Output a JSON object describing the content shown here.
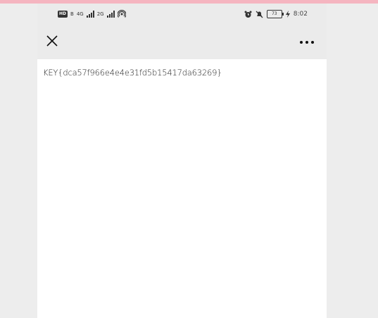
{
  "status_bar": {
    "hd": "HD",
    "b": "B",
    "net1": "4G",
    "net2": "2G",
    "battery": "73",
    "time": "8:02"
  },
  "icons": {
    "close": "close-icon",
    "more": "more-icon",
    "alarm": "alarm-icon",
    "mute": "mute-icon",
    "hotspot": "hotspot-icon",
    "charging": "charging-icon"
  },
  "document": {
    "text": "KEY{dca57f966e4e4e31fd5b15417da63269}"
  },
  "colors": {
    "accent_strip": "#f5b5c0",
    "toolbar_bg": "#ebebeb",
    "page_bg": "#ededed"
  }
}
